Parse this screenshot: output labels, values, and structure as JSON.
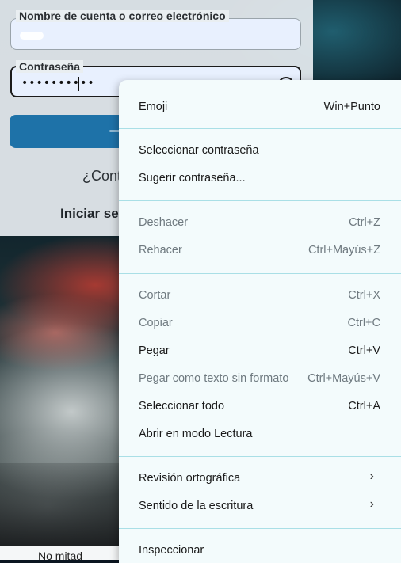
{
  "login": {
    "username_label": "Nombre de cuenta o correo electrónico",
    "password_label": "Contraseña",
    "password_value": "••••••••••",
    "submit_arrow": "→",
    "help_text": "¿Cont",
    "signin_text": "Iniciar se",
    "bottom_text": "No mitad"
  },
  "context_menu": {
    "items": [
      {
        "label": "Emoji",
        "shortcut": "Win+Punto",
        "disabled": false
      },
      {
        "label": "Seleccionar contraseña",
        "shortcut": "",
        "disabled": false
      },
      {
        "label": "Sugerir contraseña...",
        "shortcut": "",
        "disabled": false
      },
      {
        "label": "Deshacer",
        "shortcut": "Ctrl+Z",
        "disabled": true
      },
      {
        "label": "Rehacer",
        "shortcut": "Ctrl+Mayús+Z",
        "disabled": true
      },
      {
        "label": "Cortar",
        "shortcut": "Ctrl+X",
        "disabled": true
      },
      {
        "label": "Copiar",
        "shortcut": "Ctrl+C",
        "disabled": true
      },
      {
        "label": "Pegar",
        "shortcut": "Ctrl+V",
        "disabled": false
      },
      {
        "label": "Pegar como texto sin formato",
        "shortcut": "Ctrl+Mayús+V",
        "disabled": true
      },
      {
        "label": "Seleccionar todo",
        "shortcut": "Ctrl+A",
        "disabled": false
      },
      {
        "label": "Abrir en modo Lectura",
        "shortcut": "",
        "disabled": false
      },
      {
        "label": "Revisión ortográfica",
        "shortcut": "",
        "disabled": false,
        "submenu": true
      },
      {
        "label": "Sentido de la escritura",
        "shortcut": "",
        "disabled": false,
        "submenu": true
      },
      {
        "label": "Inspeccionar",
        "shortcut": "",
        "disabled": false
      }
    ]
  },
  "icons": {
    "submit": "arrow-right-icon",
    "password_toggle": "eye-icon",
    "submenu": "chevron-right-icon"
  },
  "colors": {
    "accent": "#1e72a8",
    "menu_bg": "#f3fbfc",
    "separator": "#a9dfe6"
  }
}
